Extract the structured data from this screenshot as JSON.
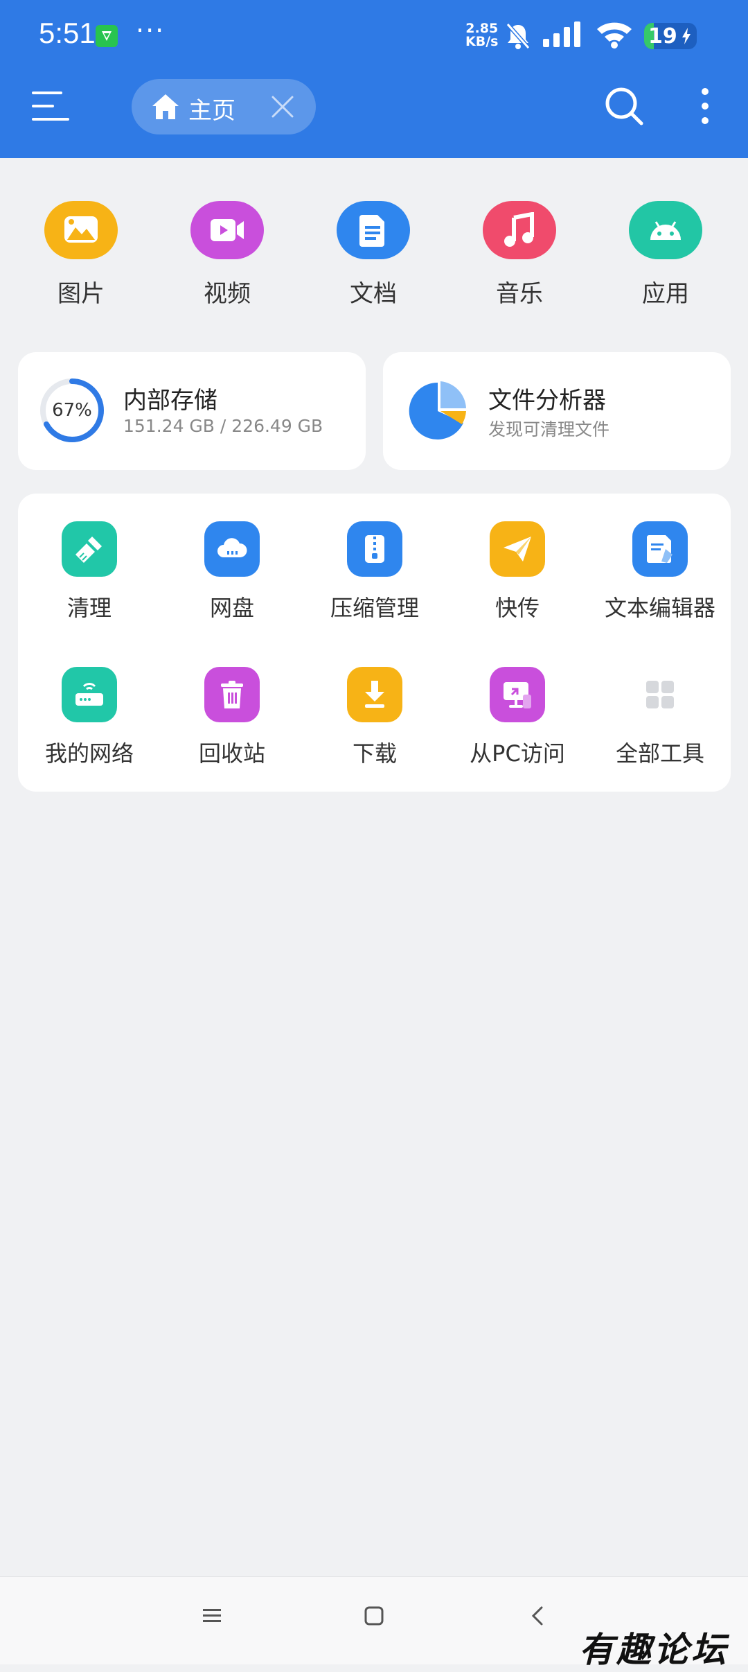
{
  "status_bar": {
    "time": "5:51",
    "more": "···",
    "net_speed_value": "2.85",
    "net_speed_unit": "KB/s",
    "battery": "19",
    "battery_level": 0.19
  },
  "app_bar": {
    "tab_label": "主页",
    "color": "#2f7ae5"
  },
  "categories": [
    {
      "label": "图片",
      "icon": "image-icon",
      "color": "#f7b316"
    },
    {
      "label": "视频",
      "icon": "video-icon",
      "color": "#c94fdc"
    },
    {
      "label": "文档",
      "icon": "document-icon",
      "color": "#2f86ee"
    },
    {
      "label": "音乐",
      "icon": "music-icon",
      "color": "#f04b6c"
    },
    {
      "label": "应用",
      "icon": "android-icon",
      "color": "#22c6a5"
    }
  ],
  "storage": {
    "title": "内部存储",
    "percent": "67%",
    "used_fraction": 0.67,
    "detail": "151.24 GB / 226.49 GB"
  },
  "analyzer": {
    "title": "文件分析器",
    "subtitle": "发现可清理文件"
  },
  "tools": [
    {
      "label": "清理",
      "icon": "broom-icon",
      "color": "#21c7a8"
    },
    {
      "label": "网盘",
      "icon": "cloud-icon",
      "color": "#2f86ee"
    },
    {
      "label": "压缩管理",
      "icon": "zip-icon",
      "color": "#2f86ee"
    },
    {
      "label": "快传",
      "icon": "paper-plane-icon",
      "color": "#f7b316"
    },
    {
      "label": "文本编辑器",
      "icon": "text-edit-icon",
      "color": "#2f86ee"
    },
    {
      "label": "我的网络",
      "icon": "router-icon",
      "color": "#21c7a8"
    },
    {
      "label": "回收站",
      "icon": "trash-icon",
      "color": "#c94fdc"
    },
    {
      "label": "下载",
      "icon": "download-icon",
      "color": "#f7b316"
    },
    {
      "label": "从PC访问",
      "icon": "pc-access-icon",
      "color": "#c94fdc"
    },
    {
      "label": "全部工具",
      "icon": "grid-icon",
      "color": "#ffffff"
    }
  ],
  "watermark": "有趣论坛"
}
